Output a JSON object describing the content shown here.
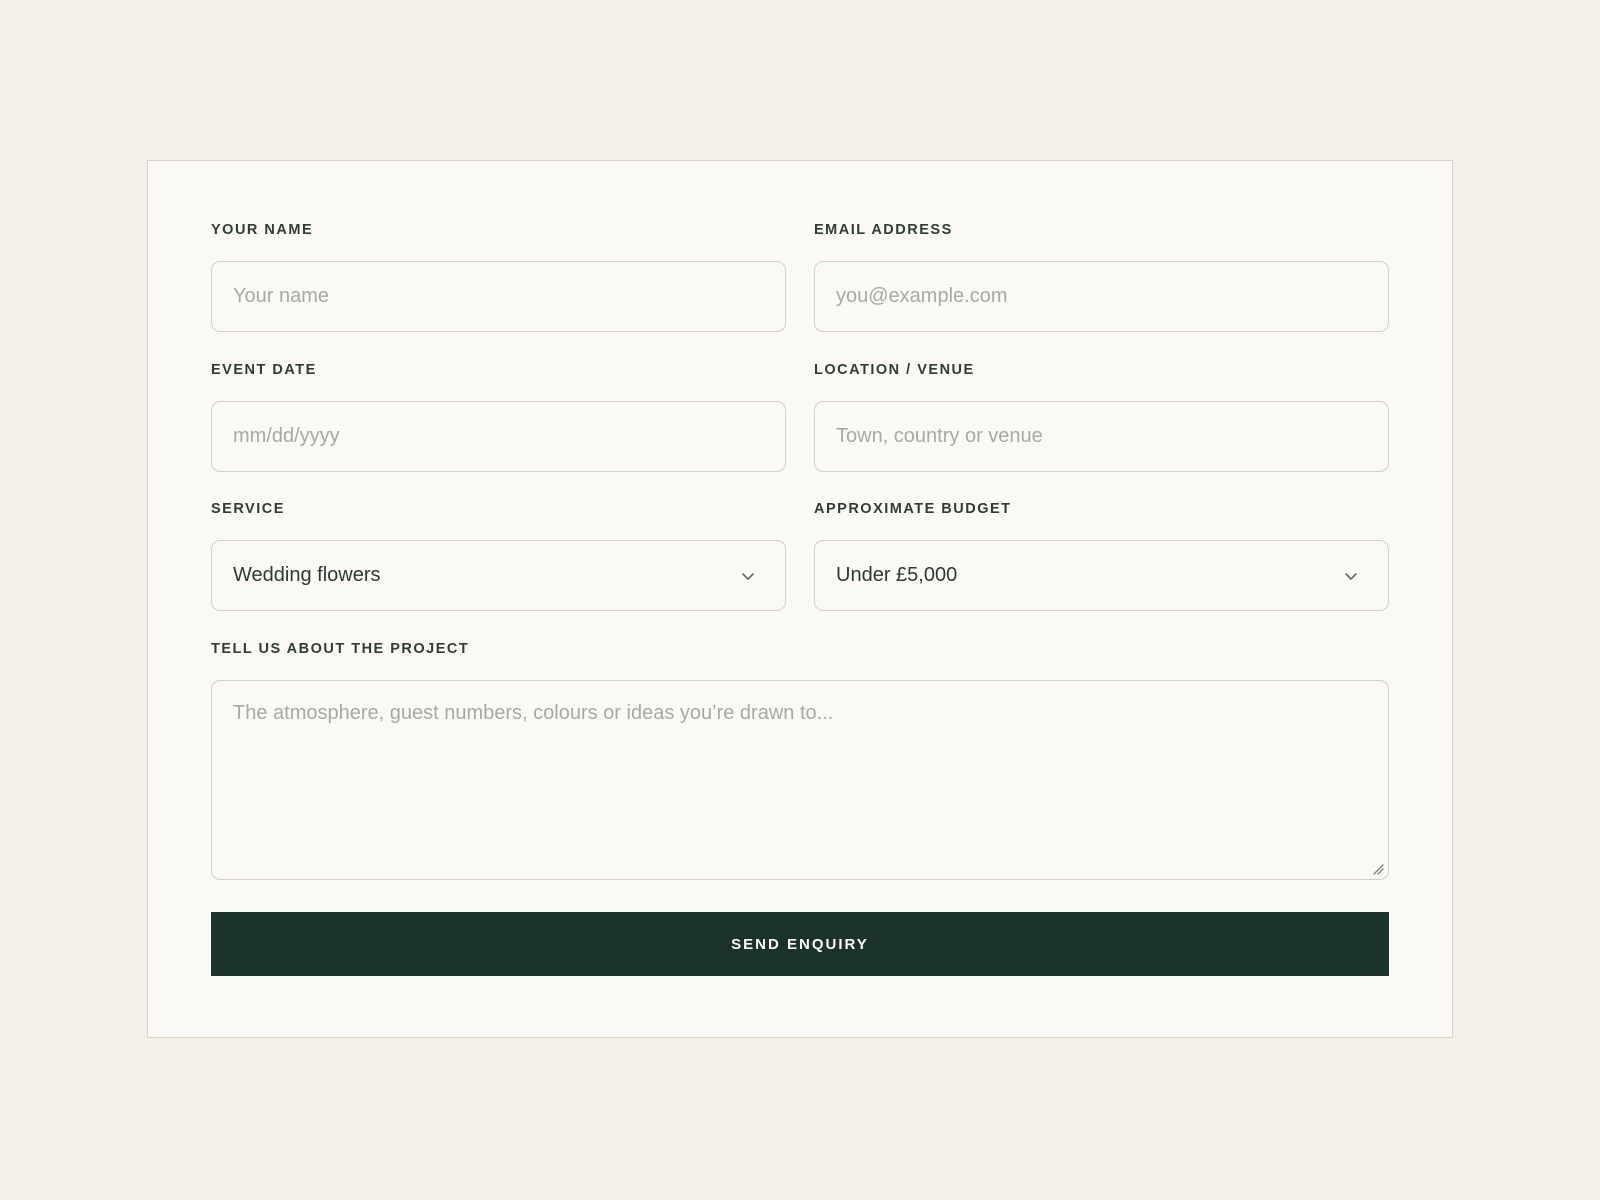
{
  "form": {
    "name": {
      "label": "YOUR NAME",
      "placeholder": "Your name",
      "value": ""
    },
    "email": {
      "label": "EMAIL ADDRESS",
      "placeholder": "you@example.com",
      "value": ""
    },
    "event_date": {
      "label": "EVENT DATE",
      "placeholder": "mm/dd/yyyy",
      "value": ""
    },
    "location": {
      "label": "LOCATION / VENUE",
      "placeholder": "Town, country or venue",
      "value": ""
    },
    "service": {
      "label": "SERVICE",
      "selected": "Wedding flowers",
      "icon": "chevron-down-icon"
    },
    "budget": {
      "label": "APPROXIMATE BUDGET",
      "selected": "Under £5,000",
      "icon": "chevron-down-icon"
    },
    "project": {
      "label": "TELL US ABOUT THE PROJECT",
      "placeholder": "The atmosphere, guest numbers, colours or ideas you’re drawn to..."
    },
    "submit_label": "SEND ENQUIRY"
  },
  "colors": {
    "page_background": "#f4f0e8",
    "card_background": "#faf9f5",
    "button_background": "#1c332d",
    "button_text": "#ffffff",
    "label_text": "#2f3d36",
    "placeholder_text": "#a6aaa5"
  }
}
